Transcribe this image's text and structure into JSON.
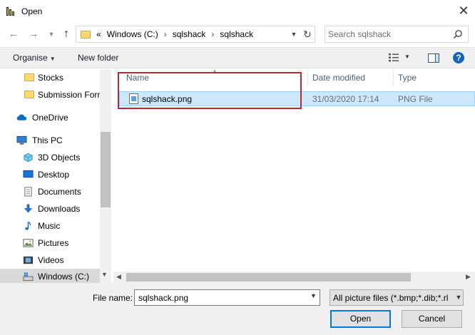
{
  "window": {
    "title": "Open",
    "app_icon": "power-bi-icon",
    "close_icon": "close-icon"
  },
  "nav": {
    "back_icon": "back-arrow-icon",
    "forward_icon": "forward-arrow-icon",
    "recent_icon": "chevron-down-icon",
    "up_icon": "up-arrow-icon"
  },
  "address": {
    "overflow": "«",
    "crumbs": [
      "Windows (C:)",
      "sqlshack",
      "sqlshack"
    ],
    "separator": "›",
    "refresh_icon": "refresh-icon"
  },
  "search": {
    "placeholder": "Search sqlshack",
    "icon": "search-icon"
  },
  "toolbar": {
    "organise": "Organise",
    "new_folder": "New folder",
    "help": "?"
  },
  "sidebar": {
    "items": [
      {
        "label": "Stocks",
        "icon": "folder-icon"
      },
      {
        "label": "Submission Forr",
        "icon": "folder-icon"
      },
      {
        "label": "OneDrive",
        "icon": "onedrive-icon"
      },
      {
        "label": "This PC",
        "icon": "this-pc-icon"
      },
      {
        "label": "3D Objects",
        "icon": "3d-objects-icon"
      },
      {
        "label": "Desktop",
        "icon": "desktop-icon"
      },
      {
        "label": "Documents",
        "icon": "documents-icon"
      },
      {
        "label": "Downloads",
        "icon": "downloads-icon"
      },
      {
        "label": "Music",
        "icon": "music-icon"
      },
      {
        "label": "Pictures",
        "icon": "pictures-icon"
      },
      {
        "label": "Videos",
        "icon": "videos-icon"
      },
      {
        "label": "Windows (C:)",
        "icon": "drive-icon"
      }
    ]
  },
  "columns": {
    "name": "Name",
    "date": "Date modified",
    "type": "Type"
  },
  "files": [
    {
      "name": "sqlshack.png",
      "date": "31/03/2020 17:14",
      "type": "PNG File",
      "icon": "png-file-icon"
    }
  ],
  "footer": {
    "file_name_label": "File name:",
    "file_name_value": "sqlshack.png",
    "filter": "All picture files (*.bmp;*.dib;*.rl",
    "open": "Open",
    "cancel": "Cancel"
  },
  "colors": {
    "selection": "#cce8ff",
    "highlight_border": "#c0262d",
    "accent": "#0078d7"
  }
}
